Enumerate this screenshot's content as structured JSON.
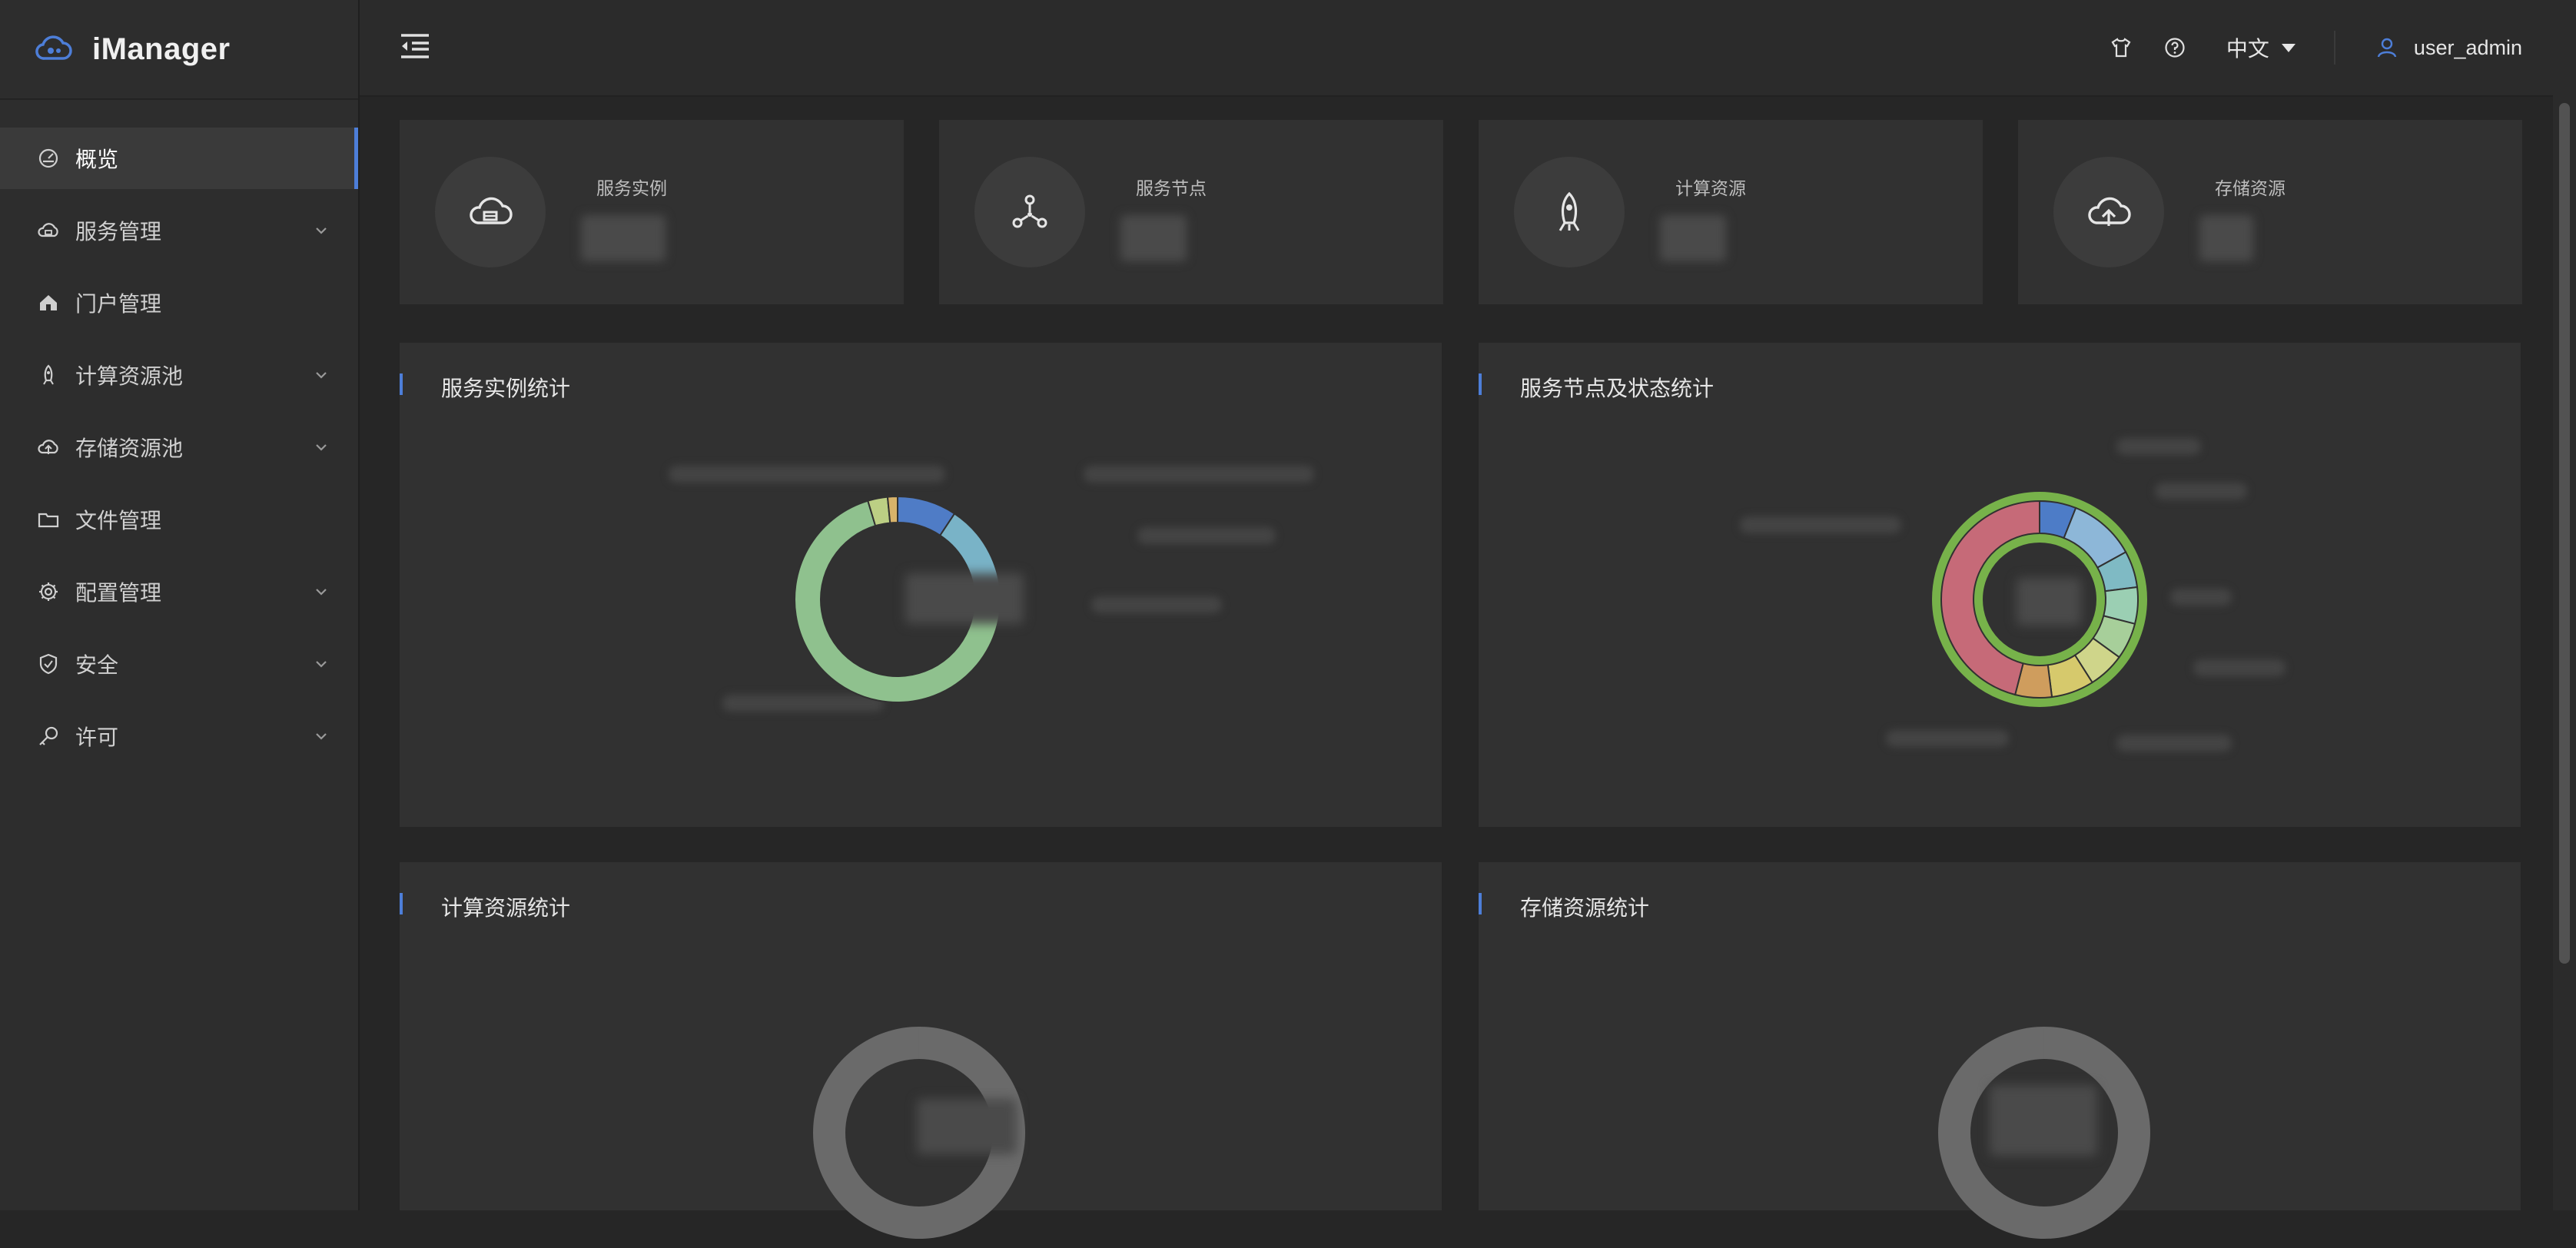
{
  "app": {
    "title": "iManager",
    "colors": {
      "accent": "#4d7ed8",
      "background": "#262626",
      "panel": "#313131",
      "sidebar": "#2d2d2d"
    }
  },
  "sidebar": {
    "items": [
      {
        "label": "概览",
        "icon": "dashboard-icon",
        "active": true,
        "expandable": false
      },
      {
        "label": "服务管理",
        "icon": "cloud-service-icon",
        "active": false,
        "expandable": true
      },
      {
        "label": "门户管理",
        "icon": "home-icon",
        "active": false,
        "expandable": false
      },
      {
        "label": "计算资源池",
        "icon": "rocket-icon",
        "active": false,
        "expandable": true
      },
      {
        "label": "存储资源池",
        "icon": "cloud-upload-icon",
        "active": false,
        "expandable": true
      },
      {
        "label": "文件管理",
        "icon": "folder-icon",
        "active": false,
        "expandable": false
      },
      {
        "label": "配置管理",
        "icon": "gear-icon",
        "active": false,
        "expandable": true
      },
      {
        "label": "安全",
        "icon": "shield-icon",
        "active": false,
        "expandable": true
      },
      {
        "label": "许可",
        "icon": "key-icon",
        "active": false,
        "expandable": true
      }
    ]
  },
  "header": {
    "collapse_icon": "menu-collapse-icon",
    "theme_icon": "shirt-icon",
    "help_icon": "help-icon",
    "language": "中文",
    "user_name": "user_admin",
    "user_icon": "user-icon"
  },
  "cards": [
    {
      "label": "服务实例",
      "icon": "cloud-service-icon"
    },
    {
      "label": "服务节点",
      "icon": "node-icon"
    },
    {
      "label": "计算资源",
      "icon": "rocket-icon"
    },
    {
      "label": "存储资源",
      "icon": "cloud-upload-icon"
    }
  ],
  "panels": {
    "service_instances": {
      "title": "服务实例统计"
    },
    "service_nodes": {
      "title": "服务节点及状态统计"
    },
    "compute": {
      "title": "计算资源统计"
    },
    "storage": {
      "title": "存储资源统计"
    }
  },
  "chart_data": [
    {
      "type": "pie",
      "variant": "donut",
      "colors": [
        "#4f7cc6",
        "#79b3c7",
        "#8cc4c8",
        "#8fc18e",
        "#bccf84",
        "#d8b36a"
      ],
      "values": [
        9,
        16,
        1,
        66,
        3,
        1.5
      ]
    },
    {
      "type": "pie",
      "variant": "donut",
      "colors": [
        "#4d7cc7",
        "#8db7d8",
        "#7fbac4",
        "#9bcfb3",
        "#a7cf9a",
        "#cfd58a",
        "#d6c96c",
        "#cf9d5d",
        "#c66a78"
      ],
      "values": [
        6,
        11,
        6,
        6,
        6,
        6,
        7,
        6,
        46
      ]
    },
    {
      "type": "pie",
      "variant": "donut",
      "colors": [
        "#6a6a6a"
      ],
      "values": [
        100
      ]
    },
    {
      "type": "pie",
      "variant": "donut",
      "colors": [
        "#6a6a6a"
      ],
      "values": [
        100
      ]
    }
  ]
}
